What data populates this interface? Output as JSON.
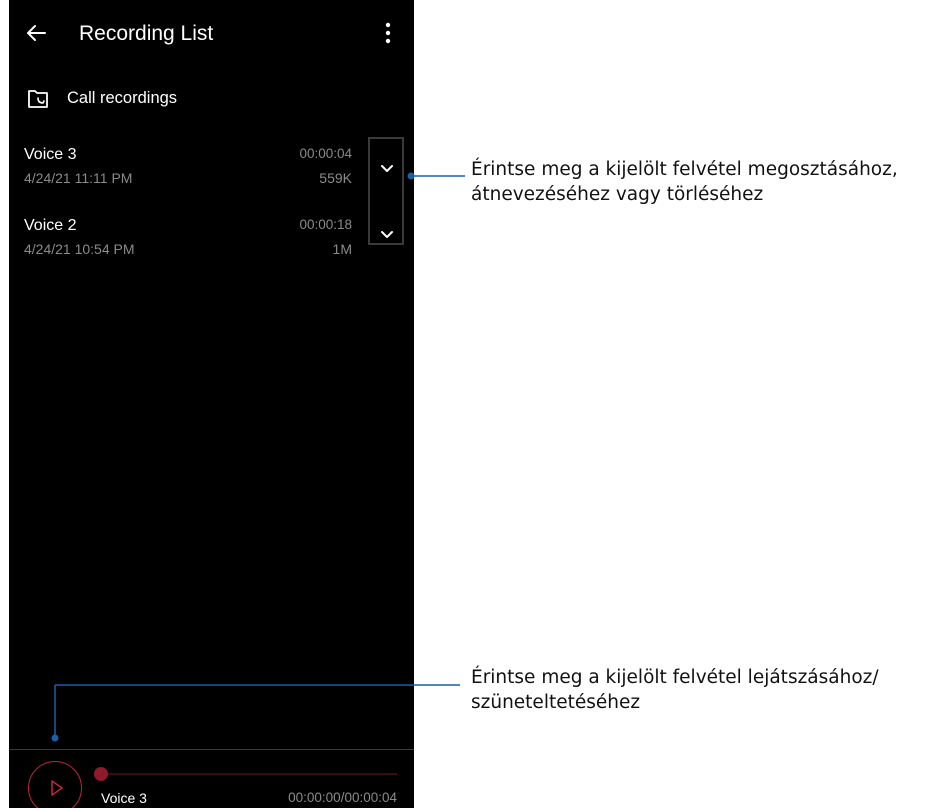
{
  "header": {
    "title": "Recording List",
    "back_icon": "arrow-left-icon",
    "menu_icon": "more-vert-icon"
  },
  "folder": {
    "label": "Call recordings",
    "icon": "folder-call-icon"
  },
  "recordings": [
    {
      "name": "Voice 3",
      "date": "4/24/21 11:11 PM",
      "duration": "00:00:04",
      "size": "559K"
    },
    {
      "name": "Voice 2",
      "date": "4/24/21 10:54 PM",
      "duration": "00:00:18",
      "size": "1M"
    }
  ],
  "player": {
    "name": "Voice 3",
    "time": "00:00:00/00:00:04",
    "progress": 0,
    "play_icon": "play-icon"
  },
  "annotations": {
    "menu_line1": "Érintse meg a kijelölt felvétel megosztásához,",
    "menu_line2": "átnevezéséhez vagy törléséhez",
    "play_line1": "Érintse meg a kijelölt felvétel lejátszásához/",
    "play_line2": "szüneteltetéséhez"
  },
  "colors": {
    "background": "#000000",
    "accent": "#c0243a",
    "secondary_text": "#8a8a8a",
    "callout_line": "#1a5fa8"
  }
}
